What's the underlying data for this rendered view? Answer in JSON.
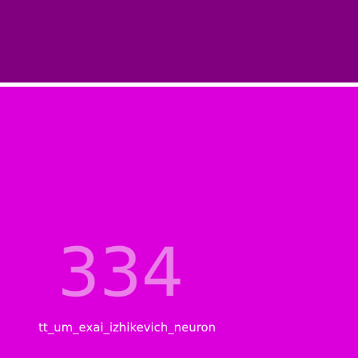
{
  "colors": {
    "top_band": "#800080",
    "divider": "#ffffff",
    "tile_background": "#db00db",
    "number_text": "#eb80eb",
    "label_text": "#ffffff"
  },
  "tile": {
    "number": "334",
    "label": "tt_um_exai_izhikevich_neuron"
  }
}
